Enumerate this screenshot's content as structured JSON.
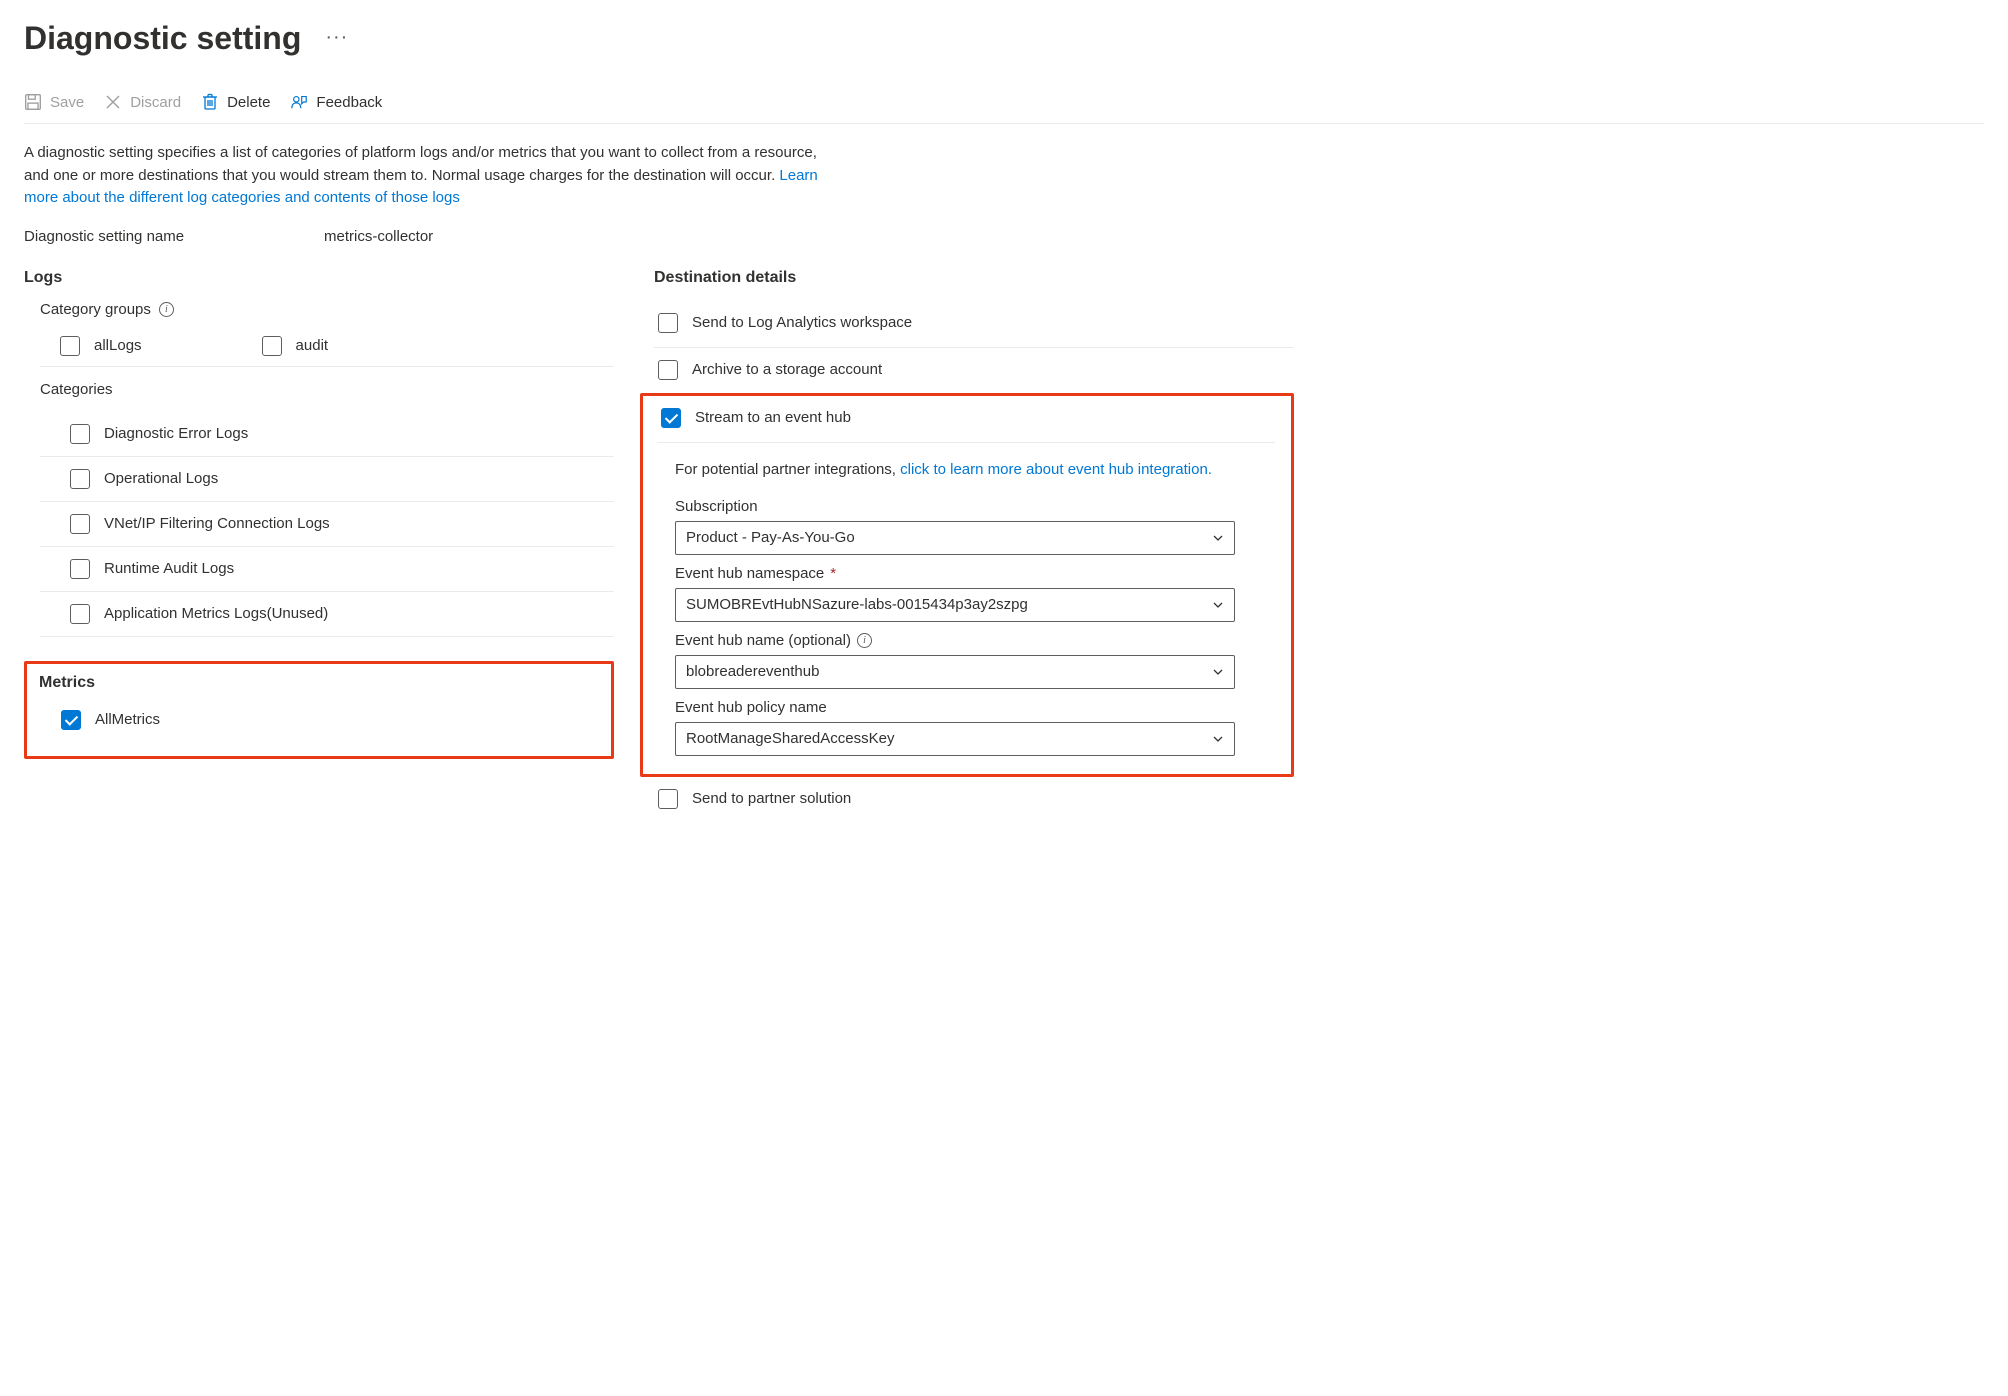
{
  "header": {
    "title": "Diagnostic setting",
    "ellipsis": "···"
  },
  "toolbar": {
    "save": "Save",
    "discard": "Discard",
    "delete": "Delete",
    "feedback": "Feedback"
  },
  "description": {
    "text_a": "A diagnostic setting specifies a list of categories of platform logs and/or metrics that you want to collect from a resource, and one or more destinations that you would stream them to. Normal usage charges for the destination will occur. ",
    "link": "Learn more about the different log categories and contents of those logs"
  },
  "setting_name": {
    "label": "Diagnostic setting name",
    "value": "metrics-collector"
  },
  "logs": {
    "heading": "Logs",
    "category_groups_label": "Category groups",
    "groups": {
      "all_logs": "allLogs",
      "audit": "audit"
    },
    "categories_label": "Categories",
    "categories": [
      "Diagnostic Error Logs",
      "Operational Logs",
      "VNet/IP Filtering Connection Logs",
      "Runtime Audit Logs",
      "Application Metrics Logs(Unused)"
    ]
  },
  "metrics": {
    "heading": "Metrics",
    "all_metrics": "AllMetrics"
  },
  "destinations": {
    "heading": "Destination details",
    "log_analytics": "Send to Log Analytics workspace",
    "storage": "Archive to a storage account",
    "event_hub": {
      "label": "Stream to an event hub",
      "note_prefix": "For potential partner integrations, ",
      "note_link": "click to learn more about event hub integration.",
      "subscription_label": "Subscription",
      "subscription_value": "Product - Pay-As-You-Go",
      "namespace_label": "Event hub namespace",
      "namespace_value": "SUMOBREvtHubNSazure-labs-0015434p3ay2szpg",
      "name_label": "Event hub name (optional)",
      "name_value": "blobreadereventhub",
      "policy_label": "Event hub policy name",
      "policy_value": "RootManageSharedAccessKey",
      "required_mark": "*"
    },
    "partner": "Send to partner solution"
  }
}
